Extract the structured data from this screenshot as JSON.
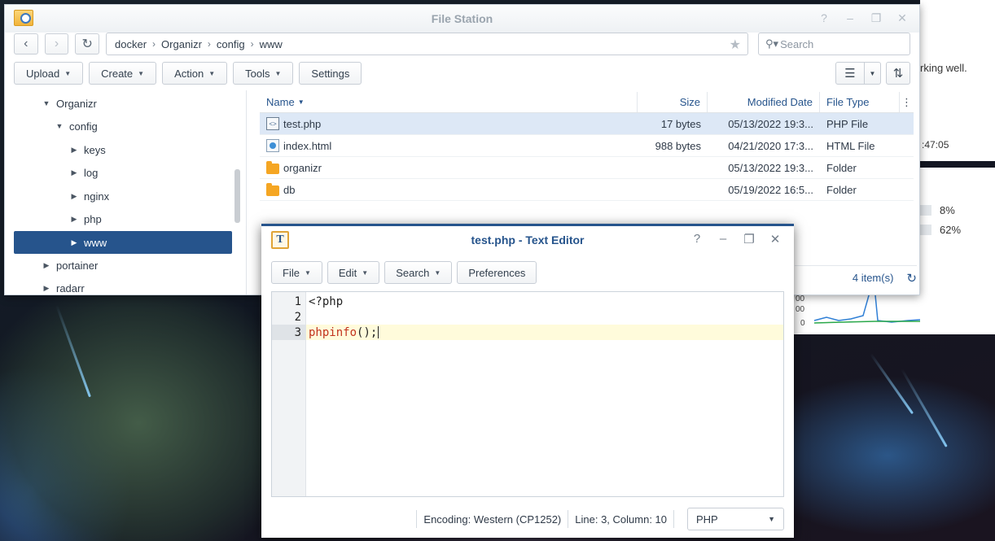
{
  "file_station": {
    "title": "File Station",
    "window_controls": [
      "?",
      "–",
      "❐",
      "✕"
    ],
    "path": [
      "docker",
      "Organizr",
      "config",
      "www"
    ],
    "search_placeholder": "Search",
    "toolbar": {
      "upload": "Upload",
      "create": "Create",
      "action": "Action",
      "tools": "Tools",
      "settings": "Settings"
    },
    "tree": [
      {
        "label": "Organizr",
        "expanded": true
      },
      {
        "label": "config",
        "expanded": true
      },
      {
        "label": "keys"
      },
      {
        "label": "log"
      },
      {
        "label": "nginx"
      },
      {
        "label": "php"
      },
      {
        "label": "www",
        "selected": true
      },
      {
        "label": "portainer"
      },
      {
        "label": "radarr"
      }
    ],
    "columns": {
      "name": "Name",
      "size": "Size",
      "modified": "Modified Date",
      "type": "File Type"
    },
    "files": [
      {
        "name": "test.php",
        "size": "17 bytes",
        "modified": "05/13/2022 19:3...",
        "type": "PHP File",
        "icon": "php-file-icon",
        "selected": true
      },
      {
        "name": "index.html",
        "size": "988 bytes",
        "modified": "04/21/2020 17:3...",
        "type": "HTML File",
        "icon": "html-file-icon"
      },
      {
        "name": "organizr",
        "size": "",
        "modified": "05/13/2022 19:3...",
        "type": "Folder",
        "icon": "folder-icon"
      },
      {
        "name": "db",
        "size": "",
        "modified": "05/19/2022 16:5...",
        "type": "Folder",
        "icon": "folder-icon"
      }
    ],
    "item_count": "4 item(s)"
  },
  "background_widget": {
    "status_text": "rking well.",
    "time_text": ":47:05",
    "percent_1": "8%",
    "percent_2": "62%",
    "axis_a": "00",
    "axis_b": "00",
    "axis_zero": "0"
  },
  "text_editor": {
    "title": "test.php - Text Editor",
    "window_controls": [
      "?",
      "–",
      "❐",
      "✕"
    ],
    "menu": {
      "file": "File",
      "edit": "Edit",
      "search": "Search",
      "preferences": "Preferences"
    },
    "lines": [
      {
        "n": "1",
        "text": "<?php"
      },
      {
        "n": "2",
        "text": ""
      },
      {
        "n": "3",
        "text": "phpinfo();"
      }
    ],
    "status": {
      "encoding": "Encoding: Western (CP1252)",
      "position": "Line: 3, Column: 10",
      "language": "PHP"
    }
  },
  "colors": {
    "accent": "#26548c",
    "selection_row": "#dde8f6",
    "keyword": "#c2331d"
  }
}
